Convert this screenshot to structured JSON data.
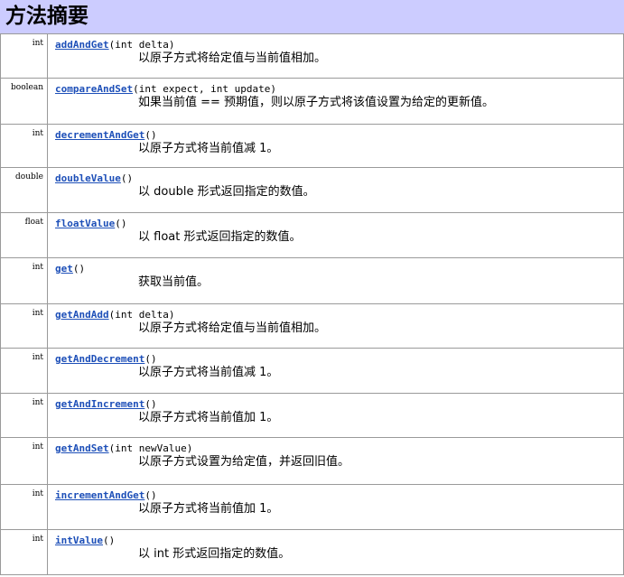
{
  "header": {
    "title": "方法摘要"
  },
  "methods": [
    {
      "return_type": "int",
      "name": "addAndGet",
      "params": "(int delta)",
      "description": "以原子方式将给定值与当前值相加。"
    },
    {
      "return_type": "boolean",
      "name": "compareAndSet",
      "params": "(int expect, int update)",
      "description": "如果当前值 == 预期值，则以原子方式将该值设置为给定的更新值。"
    },
    {
      "return_type": "int",
      "name": "decrementAndGet",
      "params": "()",
      "description": "以原子方式将当前值减 1。"
    },
    {
      "return_type": "double",
      "name": "doubleValue",
      "params": "()",
      "description": "以 double 形式返回指定的数值。"
    },
    {
      "return_type": "float",
      "name": "floatValue",
      "params": "()",
      "description": "以 float 形式返回指定的数值。"
    },
    {
      "return_type": "int",
      "name": "get",
      "params": "()",
      "description": "获取当前值。"
    },
    {
      "return_type": "int",
      "name": "getAndAdd",
      "params": "(int delta)",
      "description": "以原子方式将给定值与当前值相加。"
    },
    {
      "return_type": "int",
      "name": "getAndDecrement",
      "params": "()",
      "description": "以原子方式将当前值减 1。"
    },
    {
      "return_type": "int",
      "name": "getAndIncrement",
      "params": "()",
      "description": "以原子方式将当前值加 1。"
    },
    {
      "return_type": "int",
      "name": "getAndSet",
      "params": "(int newValue)",
      "description": "以原子方式设置为给定值，并返回旧值。"
    },
    {
      "return_type": "int",
      "name": "incrementAndGet",
      "params": "()",
      "description": "以原子方式将当前值加 1。"
    },
    {
      "return_type": "int",
      "name": "intValue",
      "params": "()",
      "description": "以 int 形式返回指定的数值。"
    }
  ]
}
